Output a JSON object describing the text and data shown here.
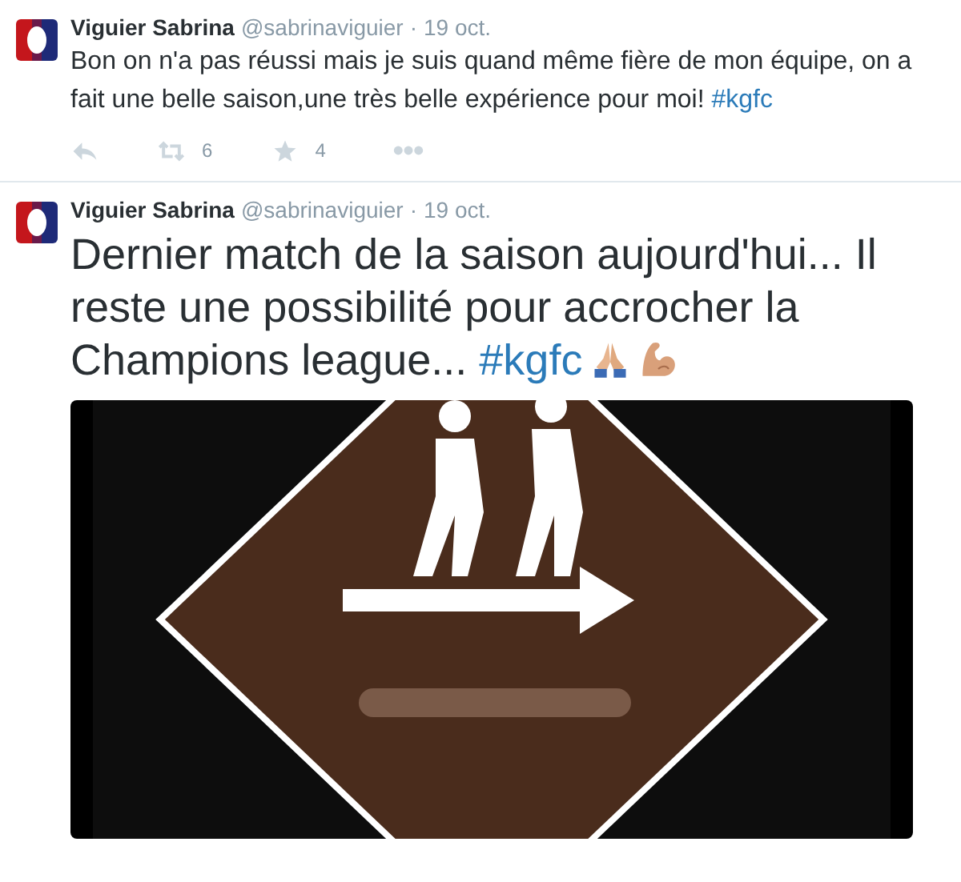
{
  "tweets": [
    {
      "kind": "compact",
      "name": "Viguier Sabrina",
      "handle": "@sabrinaviguier",
      "separator": "·",
      "date": "19 oct.",
      "text": "Bon on n'a pas réussi mais je suis quand même fière de mon équipe, on a fait une belle saison,une très belle expérience pour moi!",
      "hashtag": "#kgfc",
      "retweets": "6",
      "favorites": "4"
    },
    {
      "kind": "featured",
      "name": "Viguier Sabrina",
      "handle": "@sabrinaviguier",
      "separator": "·",
      "date": "19 oct.",
      "text": "Dernier match de la saison aujourd'hui... Il reste une possibilité pour accrocher la Champions league...",
      "hashtag": "#kgfc"
    }
  ]
}
